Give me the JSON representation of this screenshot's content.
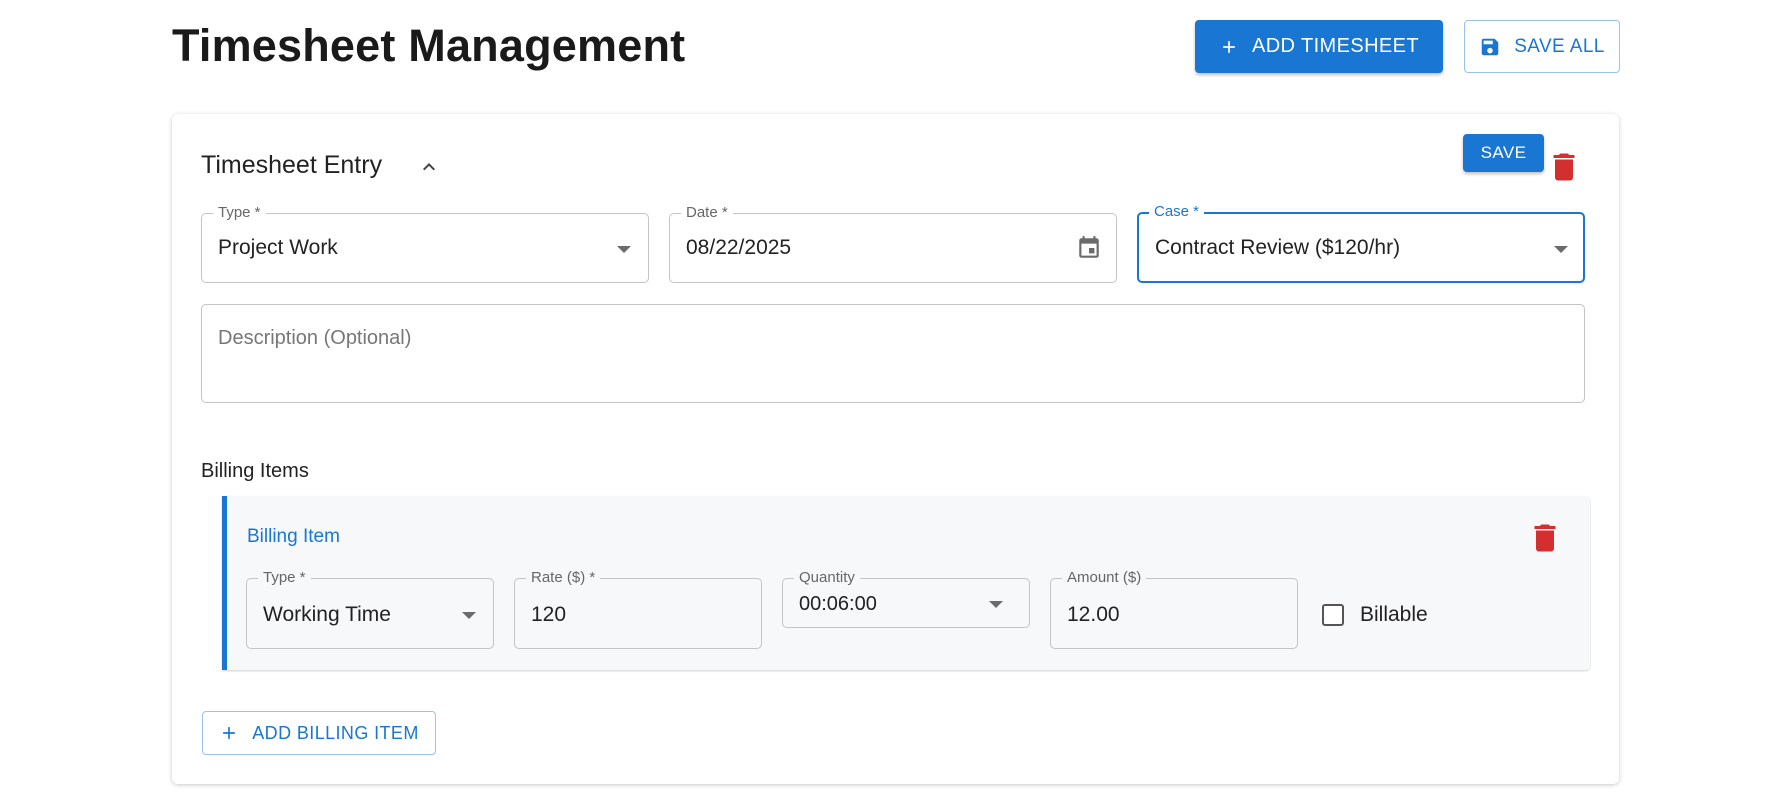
{
  "header": {
    "title": "Timesheet Management",
    "add_timesheet_label": "ADD TIMESHEET",
    "save_all_label": "SAVE ALL"
  },
  "entry": {
    "title": "Timesheet Entry",
    "save_label": "SAVE",
    "type": {
      "label": "Type *",
      "value": "Project Work"
    },
    "date": {
      "label": "Date *",
      "value": "08/22/2025"
    },
    "case": {
      "label": "Case *",
      "value": "Contract Review ($120/hr)"
    },
    "description": {
      "placeholder": "Description (Optional)",
      "value": ""
    }
  },
  "billing": {
    "section_label": "Billing Items",
    "item": {
      "title": "Billing Item",
      "type": {
        "label": "Type *",
        "value": "Working Time"
      },
      "rate": {
        "label": "Rate ($) *",
        "value": "120"
      },
      "quantity": {
        "label": "Quantity",
        "value": "00:06:00"
      },
      "amount": {
        "label": "Amount ($)",
        "value": "12.00"
      },
      "billable": {
        "label": "Billable",
        "checked": false
      }
    },
    "add_label": "ADD BILLING ITEM"
  },
  "colors": {
    "primary": "#1976d2",
    "danger": "#d32f2f",
    "border": "#c4c4c4",
    "panel_bg": "#f6f8fa"
  },
  "icons": [
    "plus-icon",
    "save-icon",
    "chevron-up-icon",
    "trash-icon",
    "calendar-icon",
    "dropdown-arrow-icon"
  ]
}
